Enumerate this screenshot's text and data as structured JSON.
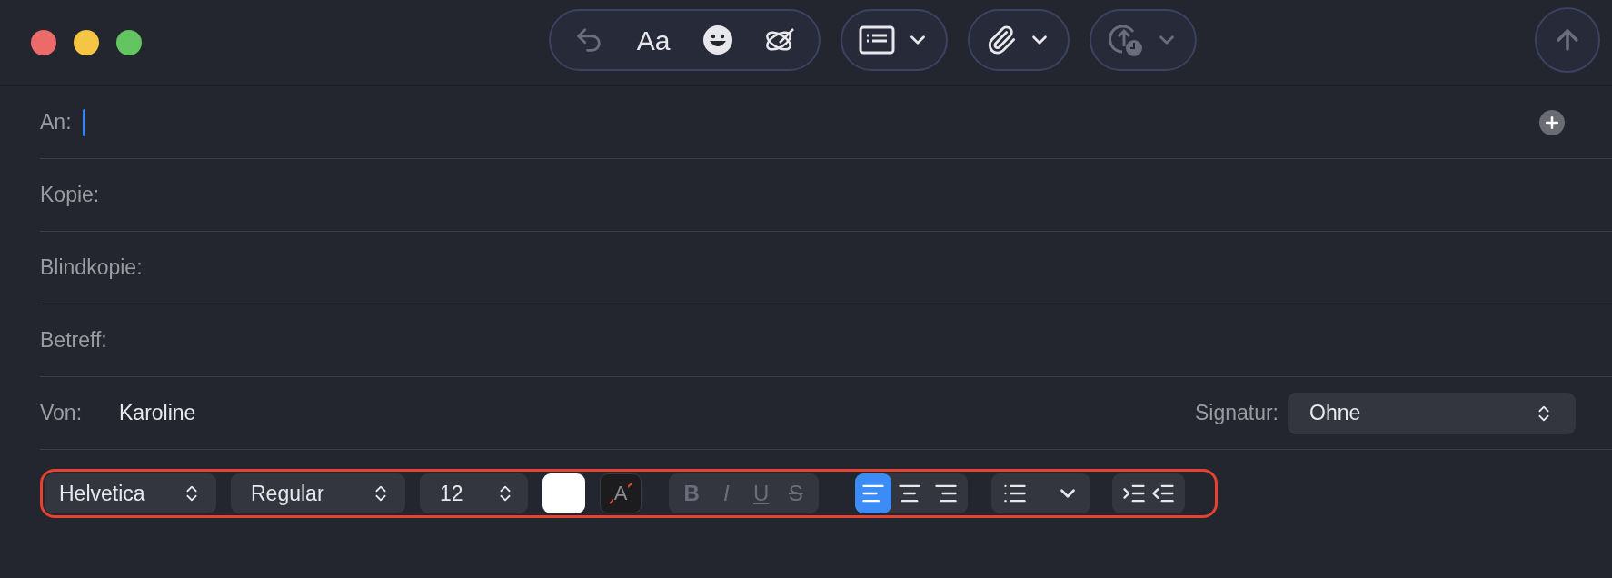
{
  "window": {
    "buttons": [
      {
        "color": "#ec6a6a"
      },
      {
        "color": "#f5c644"
      },
      {
        "color": "#62c55f"
      }
    ]
  },
  "toolbar": {
    "items": [
      {
        "kind": "reply",
        "disabled": true
      },
      {
        "kind": "format",
        "label": "Aa"
      },
      {
        "kind": "emoji"
      },
      {
        "kind": "writing"
      }
    ],
    "menus": [
      {
        "kind": "header",
        "disabled": false
      },
      {
        "kind": "attach",
        "disabled": false
      },
      {
        "kind": "schedule",
        "disabled": true
      }
    ],
    "send": {
      "disabled": true
    }
  },
  "fields": [
    {
      "kind": "recipient",
      "label": "An:",
      "focused": true
    },
    {
      "kind": "text",
      "label": "Kopie:"
    },
    {
      "kind": "text",
      "label": "Blindkopie:"
    },
    {
      "kind": "text",
      "label": "Betreff:"
    }
  ],
  "from": {
    "label": "Von:",
    "value": "Karoline",
    "signature_label": "Signatur:",
    "signature": "Ohne"
  },
  "format_bar": {
    "font": "Helvetica",
    "style": "Regular",
    "size": "12",
    "highlight_label": "A",
    "styles": [
      {
        "kind": "bold",
        "label": "B",
        "disabled": true
      },
      {
        "kind": "italic",
        "label": "I",
        "disabled": true
      },
      {
        "kind": "underline",
        "label": "U",
        "disabled": true
      },
      {
        "kind": "strike",
        "label": "S",
        "disabled": true
      }
    ],
    "alignments": [
      {
        "kind": "left",
        "selected": true
      },
      {
        "kind": "center",
        "selected": false
      },
      {
        "kind": "right",
        "selected": false
      }
    ]
  }
}
